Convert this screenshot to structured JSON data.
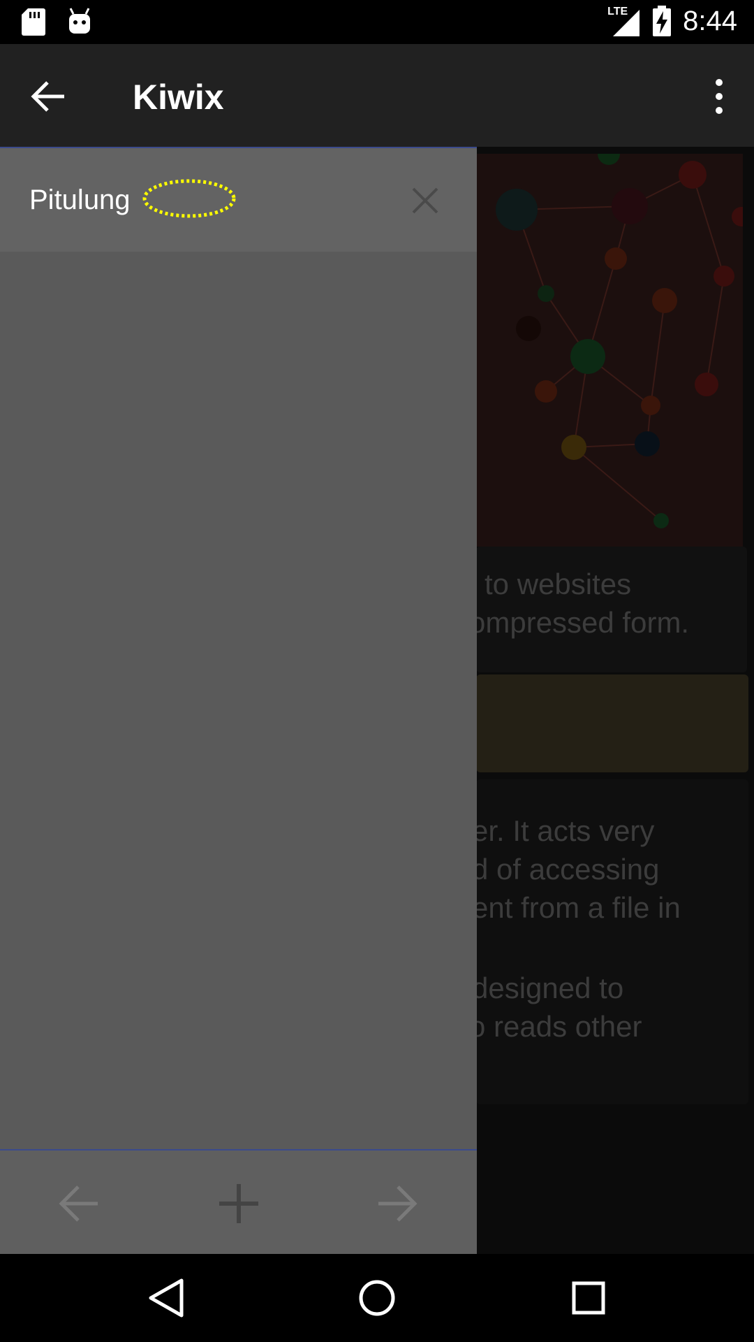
{
  "status_bar": {
    "time": "8:44",
    "network": "LTE",
    "icons": [
      "sd-card-icon",
      "android-icon",
      "signal-icon",
      "battery-charging-icon"
    ]
  },
  "app_bar": {
    "title": "Kiwix",
    "back_icon": "arrow-back-icon",
    "menu_icon": "more-vert-icon"
  },
  "drawer": {
    "tabs": [
      {
        "title": "Pitulung",
        "close_icon": "close-icon"
      }
    ],
    "bottom_bar": {
      "back_icon": "arrow-back-icon",
      "new_tab_icon": "plus-icon",
      "forward_icon": "arrow-forward-icon"
    }
  },
  "background_page": {
    "card1_lines": [
      "to websites",
      "ompressed form."
    ],
    "card2_lines": [
      "er. It acts very",
      "d of accessing",
      "ent from a file in",
      "designed to",
      "o reads other"
    ]
  },
  "nav_bar": {
    "icons": [
      "nav-back-icon",
      "nav-home-icon",
      "nav-recents-icon"
    ]
  },
  "colors": {
    "app_bar": "#212121",
    "drawer": "#5a5a5a",
    "highlight": "#ffff00",
    "divider": "#3b4a8c"
  }
}
